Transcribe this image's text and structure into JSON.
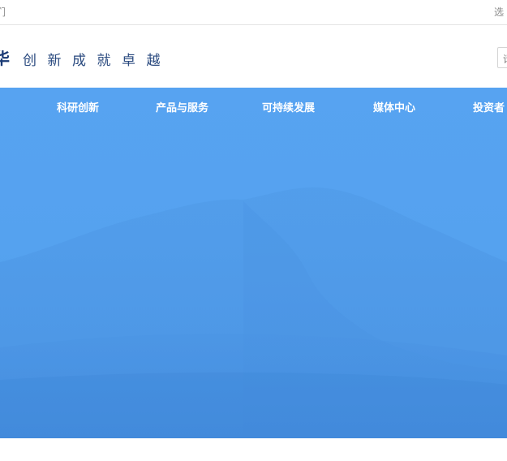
{
  "top_bar": {
    "left_link": "们",
    "right_link": "选"
  },
  "header": {
    "brand_char": "华",
    "slogan": "创新成就卓越",
    "search_placeholder": "请"
  },
  "nav": {
    "items": [
      {
        "label": "科研创新"
      },
      {
        "label": "产品与服务"
      },
      {
        "label": "可持续发展"
      },
      {
        "label": "媒体中心"
      },
      {
        "label": "投资者"
      }
    ]
  },
  "colors": {
    "brand": "#1a3a75",
    "hero_blue": "#55a2ef",
    "nav_text": "#ffffff"
  }
}
